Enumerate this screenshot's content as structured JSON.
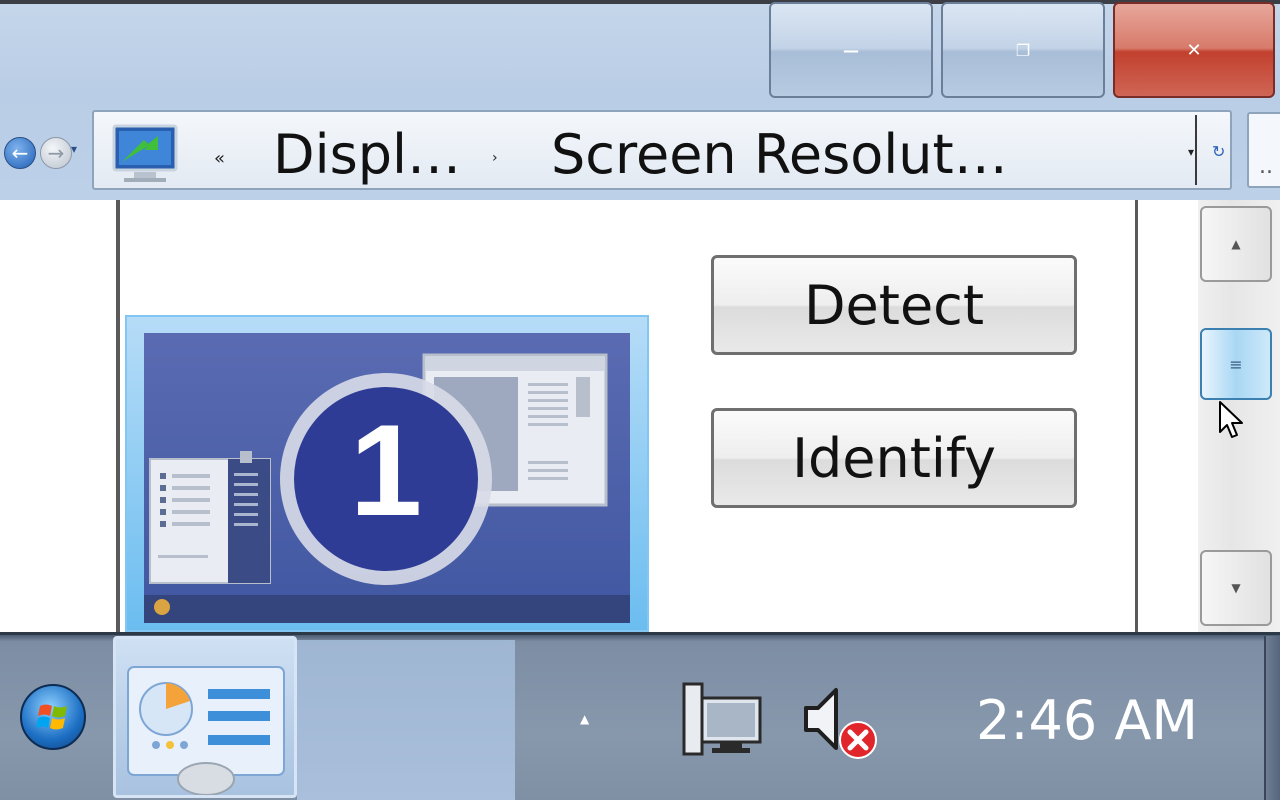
{
  "window": {
    "caption_buttons": [
      {
        "name": "minimize",
        "glyph": "—"
      },
      {
        "name": "maximize",
        "glyph": "❐"
      },
      {
        "name": "close",
        "glyph": "✕"
      }
    ],
    "close_color": "#c2402e"
  },
  "address_bar": {
    "back_glyph": "←",
    "forward_glyph": "→",
    "dropdown_glyph": "▾",
    "overflow_glyph": "«",
    "breadcrumbs": [
      "Displ…",
      "Screen Resolut…"
    ],
    "separator_glyph": "›",
    "refresh_glyph": "↻",
    "search_glyph": ".."
  },
  "content": {
    "monitor_number": "1",
    "detect_label": "Detect",
    "identify_label": "Identify"
  },
  "scrollbar": {
    "up_glyph": "▲",
    "down_glyph": "▼",
    "thumb_glyph": "≡"
  },
  "taskbar": {
    "tray_expand_glyph": "▲",
    "clock": "2:46 AM"
  },
  "icons": {
    "address_icon": "display-settings-icon",
    "taskbar_app": "control-panel-display-icon",
    "start": "windows-start-orb-icon",
    "network": "network-computer-icon",
    "volume": "volume-muted-icon"
  }
}
